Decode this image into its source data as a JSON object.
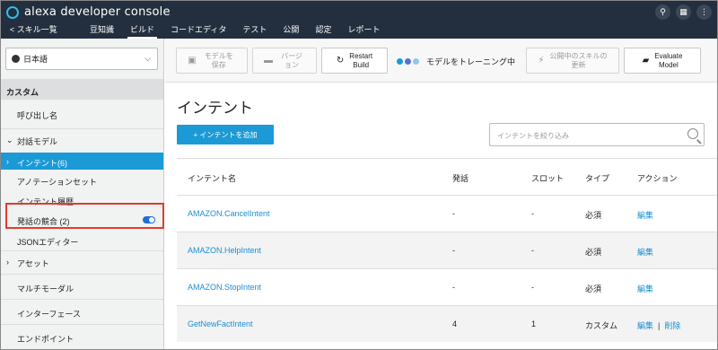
{
  "app": {
    "brand": "alexa developer console"
  },
  "topbar": {
    "icons": [
      "search-icon",
      "app-icon",
      "more-icon"
    ]
  },
  "nav": {
    "back_label": "< スキル一覧",
    "tabs": [
      "豆知識",
      "ビルド",
      "コードエディタ",
      "テスト",
      "公開",
      "認定",
      "レポート"
    ],
    "active_tab": "ビルド"
  },
  "sidebar": {
    "language": "日本語",
    "section": "カスタム",
    "items": {
      "invocation": "呼び出し名",
      "interaction_model": "対話モデル",
      "intents": "インテント(6)",
      "annotation_sets": "アノテーションセット",
      "intent_history": "インテント履歴",
      "utterance_conflicts": "発話の競合 (2)",
      "json_editor": "JSONエディター",
      "assets": "アセット",
      "multimodal": "マルチモーダル",
      "interfaces": "インターフェース",
      "endpoint": "エンドポイント"
    }
  },
  "toolbar": {
    "save_model": "モデルを保存",
    "version": "バージョン",
    "restart_build_1": "Restart",
    "restart_build_2": "Build",
    "training_status": "モデルをトレーニング中",
    "update_live_skill_1": "公開中のスキルの",
    "update_live_skill_2": "更新",
    "evaluate_model_1": "Evaluate",
    "evaluate_model_2": "Model",
    "colors": {
      "dot1": "#1b9ad6",
      "dot2": "#5a6fd6",
      "dot3": "#8fc7e8"
    }
  },
  "main": {
    "title": "インテント",
    "add_button": "+ インテントを追加",
    "filter_placeholder": "インテントを絞り込み",
    "columns": [
      "インテント名",
      "発話",
      "スロット",
      "タイプ",
      "アクション"
    ],
    "rows": [
      {
        "name": "AMAZON.CancelIntent",
        "utterances": "-",
        "slots": "-",
        "type": "必須",
        "edit": "編集",
        "delete": ""
      },
      {
        "name": "AMAZON.HelpIntent",
        "utterances": "-",
        "slots": "-",
        "type": "必須",
        "edit": "編集",
        "delete": ""
      },
      {
        "name": "AMAZON.StopIntent",
        "utterances": "-",
        "slots": "-",
        "type": "必須",
        "edit": "編集",
        "delete": ""
      },
      {
        "name": "GetNewFactIntent",
        "utterances": "4",
        "slots": "1",
        "type": "カスタム",
        "edit": "編集",
        "delete": "削除"
      }
    ]
  }
}
